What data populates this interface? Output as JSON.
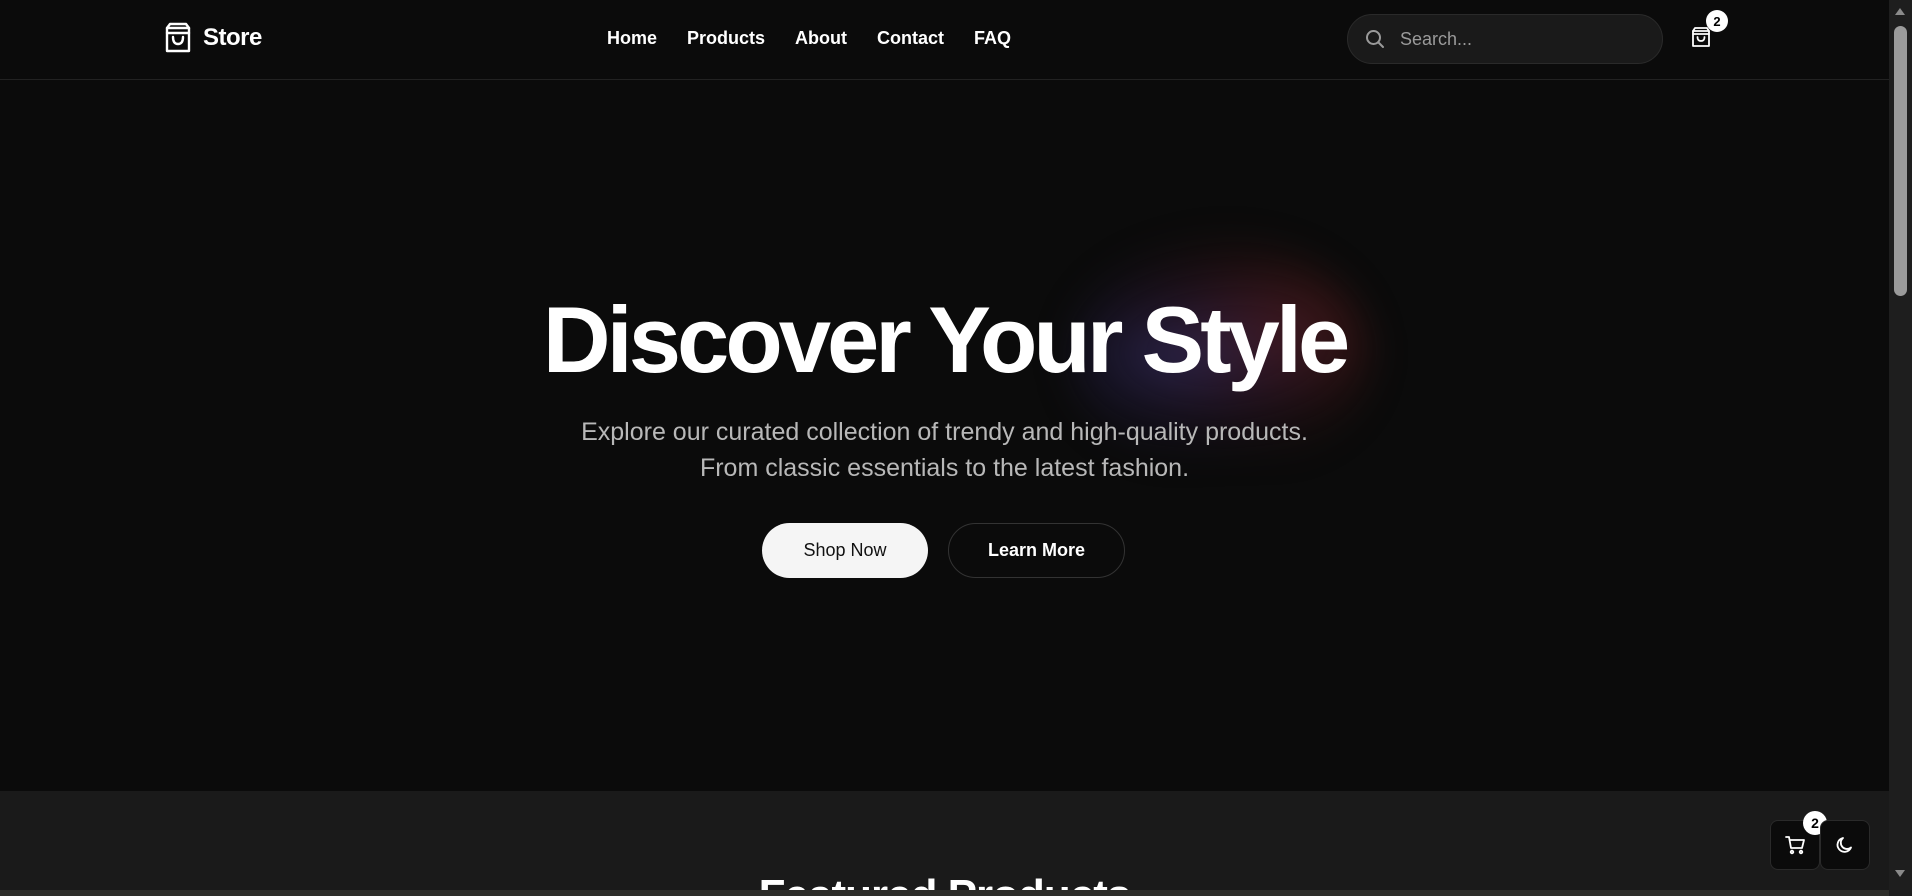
{
  "header": {
    "logo_text": "Store",
    "nav": [
      "Home",
      "Products",
      "About",
      "Contact",
      "FAQ"
    ],
    "search_placeholder": "Search...",
    "cart_count": "2"
  },
  "hero": {
    "title": "Discover Your Style",
    "subtitle_line1": "Explore our curated collection of trendy and high-quality products.",
    "subtitle_line2": "From classic essentials to the latest fashion.",
    "primary_button": "Shop Now",
    "secondary_button": "Learn More"
  },
  "featured": {
    "title": "Featured Products"
  },
  "floating": {
    "cart_count": "2"
  },
  "colors": {
    "background": "#0b0b0b",
    "section_alt": "#1a1a1a",
    "text": "#ffffff",
    "muted": "#b8b8b8"
  }
}
